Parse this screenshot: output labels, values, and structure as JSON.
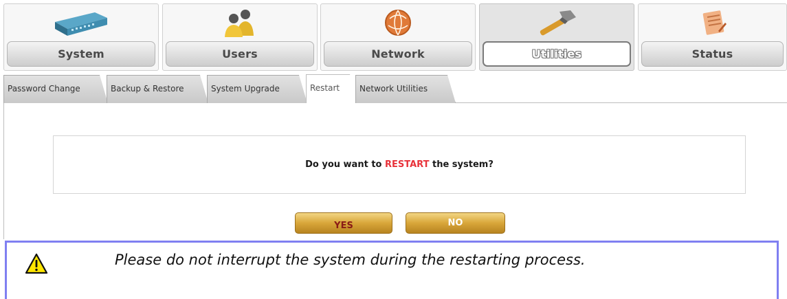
{
  "nav": {
    "items": [
      {
        "label": "System",
        "icon": "router-icon"
      },
      {
        "label": "Users",
        "icon": "users-icon"
      },
      {
        "label": "Network",
        "icon": "network-globe-icon"
      },
      {
        "label": "Utilities",
        "icon": "hammer-icon",
        "active": true
      },
      {
        "label": "Status",
        "icon": "notepad-icon"
      }
    ]
  },
  "tabs": [
    {
      "label": "Password Change"
    },
    {
      "label": "Backup & Restore"
    },
    {
      "label": "System Upgrade"
    },
    {
      "label": "Restart",
      "active": true
    },
    {
      "label": "Network Utilities"
    }
  ],
  "confirm": {
    "prefix": "Do you want to",
    "highlight": "RESTART",
    "suffix": "the system?"
  },
  "buttons": {
    "yes": "YES",
    "no": "NO"
  },
  "note": {
    "text": "Please do not interrupt the system during the restarting process.",
    "icon": "warning-icon"
  },
  "colors": {
    "highlight": "#e8323a",
    "button_gold": "#d8a63a",
    "note_border": "#7f7ff1"
  }
}
